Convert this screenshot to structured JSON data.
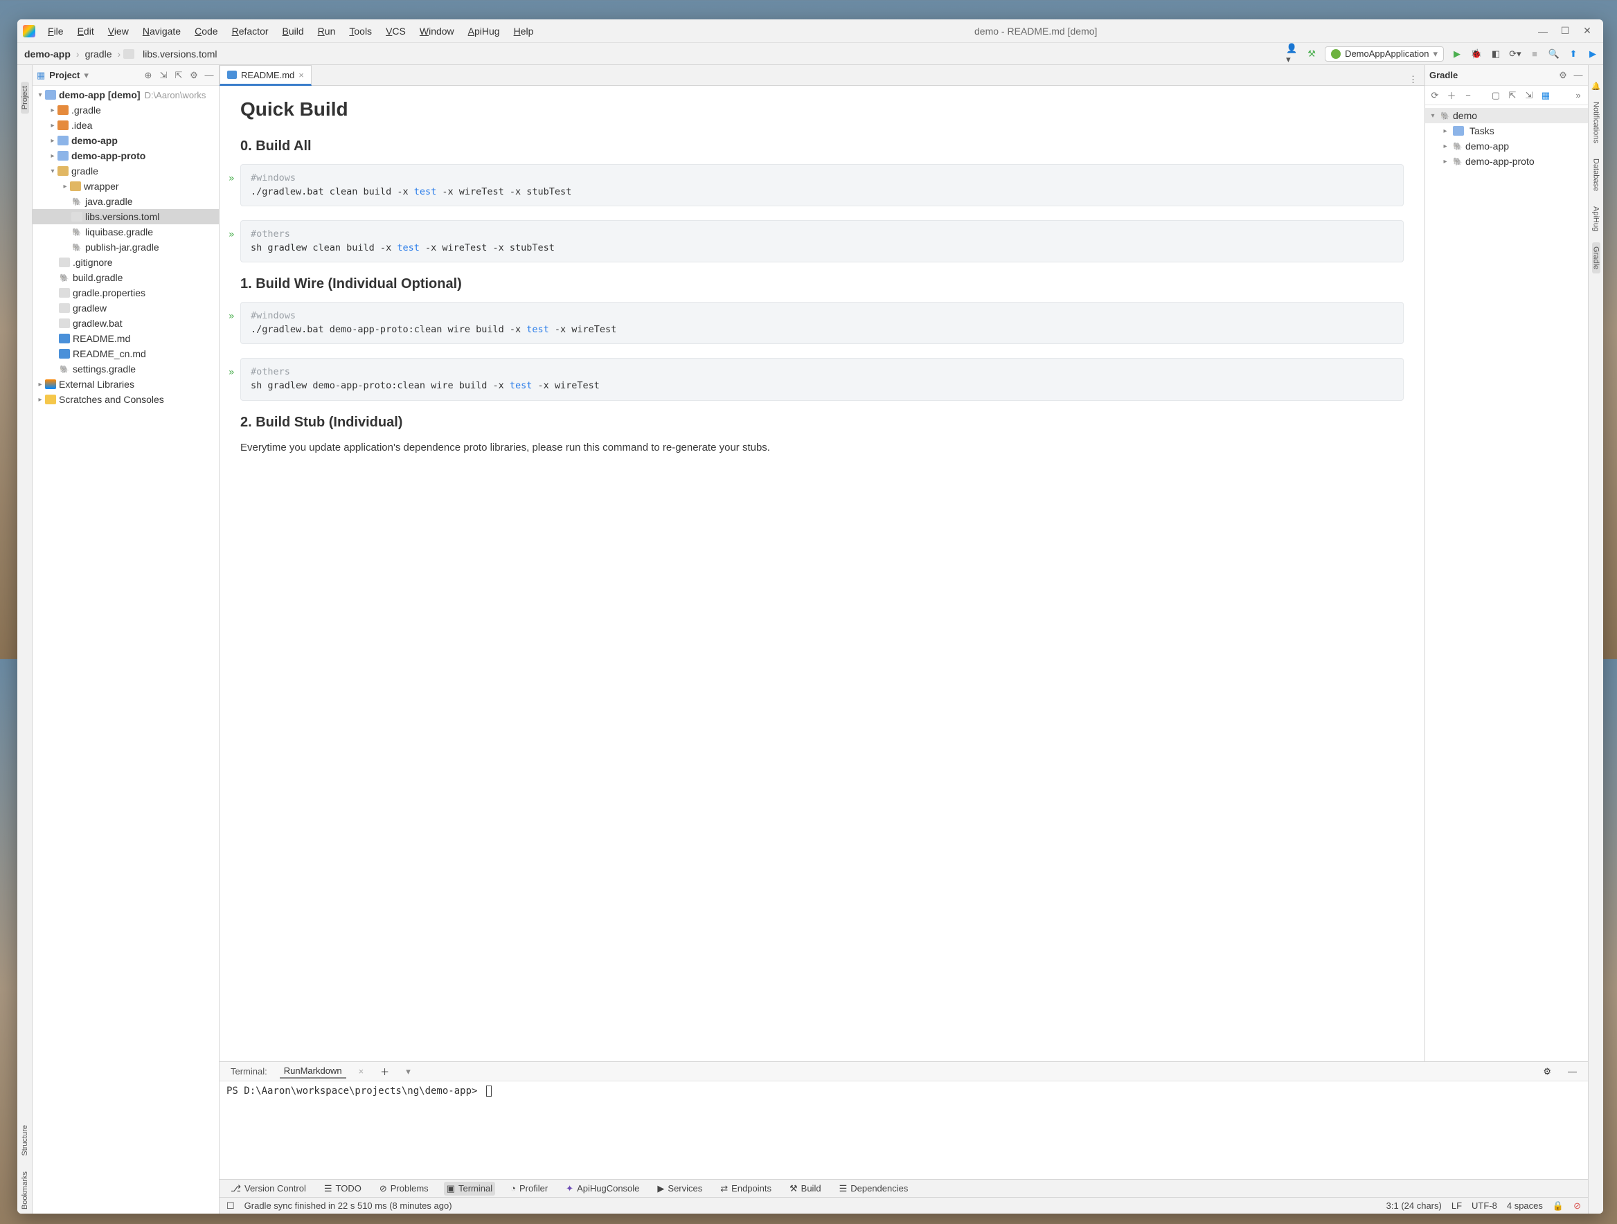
{
  "window_title": "demo - README.md [demo]",
  "menu": [
    "File",
    "Edit",
    "View",
    "Navigate",
    "Code",
    "Refactor",
    "Build",
    "Run",
    "Tools",
    "VCS",
    "Window",
    "ApiHug",
    "Help"
  ],
  "breadcrumb": [
    "demo-app",
    "gradle",
    "libs.versions.toml"
  ],
  "run_config": "DemoAppApplication",
  "project_panel": {
    "title": "Project",
    "root": {
      "name": "demo-app",
      "tag": "[demo]",
      "path": "D:\\Aaron\\works"
    },
    "items": [
      ".gradle",
      ".idea",
      "demo-app",
      "demo-app-proto",
      "gradle",
      "wrapper",
      "java.gradle",
      "libs.versions.toml",
      "liquibase.gradle",
      "publish-jar.gradle",
      ".gitignore",
      "build.gradle",
      "gradle.properties",
      "gradlew",
      "gradlew.bat",
      "README.md",
      "README_cn.md",
      "settings.gradle",
      "External Libraries",
      "Scratches and Consoles"
    ]
  },
  "tab": {
    "name": "README.md"
  },
  "readme": {
    "h1": "Quick Build",
    "s0": "0. Build All",
    "c0a_comment": "#windows",
    "c0a_pre": "./gradlew.bat clean build -x ",
    "c0a_kw": "test",
    "c0a_post": " -x wireTest -x stubTest",
    "c0b_comment": "#others",
    "c0b_pre": "sh gradlew clean build -x ",
    "c0b_kw": "test",
    "c0b_post": " -x wireTest -x stubTest",
    "s1": "1. Build Wire (Individual Optional)",
    "c1a_comment": "#windows",
    "c1a_pre": "./gradlew.bat demo-app-proto:clean wire build -x ",
    "c1a_kw": "test",
    "c1a_post": " -x wireTest",
    "c1b_comment": "#others",
    "c1b_pre": "sh gradlew demo-app-proto:clean wire build -x ",
    "c1b_kw": "test",
    "c1b_post": " -x wireTest",
    "s2": "2. Build Stub (Individual)",
    "p2": "Everytime you update application's dependence proto libraries, please run this command to re-generate your stubs."
  },
  "gradle": {
    "title": "Gradle",
    "root": "demo",
    "nodes": [
      "Tasks",
      "demo-app",
      "demo-app-proto"
    ]
  },
  "left_gutter": [
    "Project",
    "Structure",
    "Bookmarks"
  ],
  "right_gutter": [
    "Notifications",
    "Database",
    "ApiHug",
    "Gradle"
  ],
  "terminal": {
    "label": "Terminal:",
    "tab": "RunMarkdown",
    "prompt": "PS D:\\Aaron\\workspace\\projects\\ng\\demo-app> "
  },
  "bottom_tools": [
    "Version Control",
    "TODO",
    "Problems",
    "Terminal",
    "Profiler",
    "ApiHugConsole",
    "Services",
    "Endpoints",
    "Build",
    "Dependencies"
  ],
  "status": {
    "msg": "Gradle sync finished in 22 s 510 ms (8 minutes ago)",
    "pos": "3:1 (24 chars)",
    "eol": "LF",
    "enc": "UTF-8",
    "indent": "4 spaces"
  }
}
